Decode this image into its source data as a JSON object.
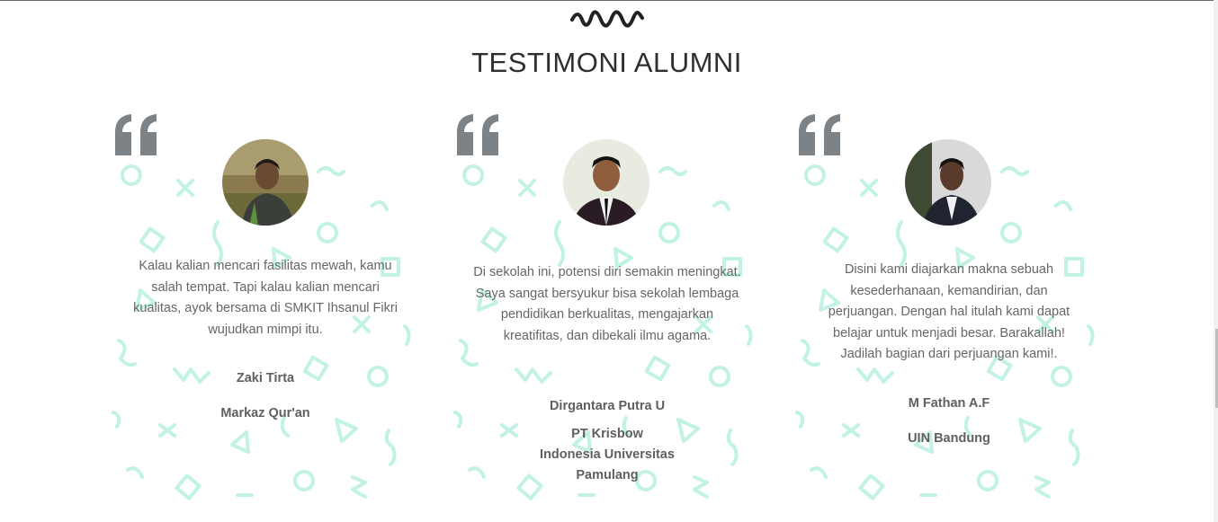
{
  "section": {
    "title": "TESTIMONI ALUMNI"
  },
  "testimonials": [
    {
      "text": "Kalau kalian mencari fasilitas mewah, kamu salah tempat. Tapi kalau kalian mencari kualitas, ayok bersama di SMKIT Ihsanul Fikri wujudkan mimpi itu.",
      "name": "Zaki Tirta",
      "org": "Markaz Qur'an"
    },
    {
      "text": "Di sekolah ini, potensi diri semakin meningkat. Saya sangat bersyukur bisa sekolah lembaga pendidikan berkualitas, mengajarkan kreatifitas, dan dibekali ilmu agama.",
      "name": "Dirgantara Putra U",
      "org": "PT Krisbow Indonesia Universitas Pamulang"
    },
    {
      "text": "Disini kami diajarkan makna sebuah kesederhanaan, kemandirian, dan perjuangan. Dengan hal itulah kami dapat belajar untuk menjadi besar. Barakallah! Jadilah bagian dari perjuangan kami!.",
      "name": "M Fathan A.F",
      "org": "UIN Bandung"
    }
  ],
  "colors": {
    "pattern": "#c2f2e5",
    "quote": "#7d8287",
    "title": "#2f2f2f",
    "text": "#666666"
  },
  "icons": {
    "quote": "quote-icon",
    "divider": "squiggle-divider-icon"
  }
}
